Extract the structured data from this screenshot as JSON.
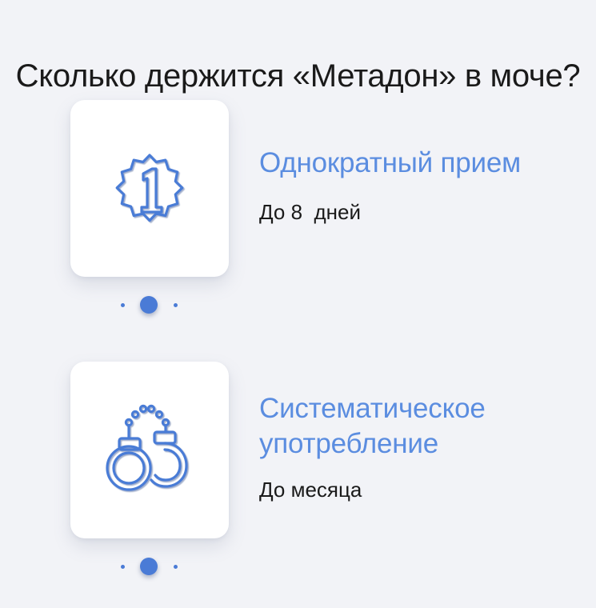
{
  "page": {
    "title": "Сколько держится «Метадон» в моче?"
  },
  "items": [
    {
      "icon": "badge-number-one-icon",
      "title": "Однократный прием",
      "description": "До 8  дней"
    },
    {
      "icon": "handcuffs-icon",
      "title": "Систематическое употребление",
      "description": "До месяца"
    }
  ],
  "colors": {
    "background": "#f2f3f7",
    "accent": "#4a7bd6",
    "title_accent": "#5b8de0",
    "text": "#1a1a1a",
    "card": "#ffffff"
  }
}
